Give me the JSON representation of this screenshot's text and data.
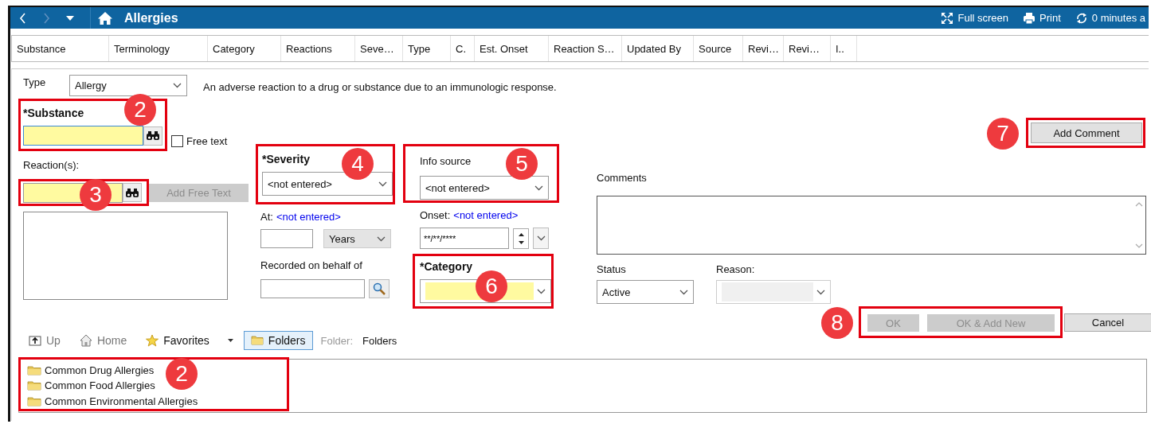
{
  "titlebar": {
    "title": "Allergies",
    "actions": [
      {
        "kind": "fullscreen",
        "label": "Full screen"
      },
      {
        "kind": "print",
        "label": "Print"
      },
      {
        "kind": "refresh",
        "label": "0 minutes a"
      }
    ]
  },
  "columns": [
    "Substance",
    "Terminology",
    "Category",
    "Reactions",
    "Seve…",
    "Type",
    "C.",
    "Est. Onset",
    "Reaction S…",
    "Updated By",
    "Source",
    "Revi…",
    "Revi…",
    "I.."
  ],
  "form": {
    "type": {
      "label": "Type",
      "value": "Allergy",
      "description": "An adverse reaction to a drug or substance due to an immunologic response."
    },
    "substance": {
      "label": "*Substance",
      "required": true,
      "callout": "2",
      "free_text": {
        "label": "Free text",
        "checked": false
      }
    },
    "reactions": {
      "label": "Reaction(s):",
      "required": true,
      "callout": "3",
      "add_button": {
        "label": "Add Free Text",
        "disabled": true
      }
    },
    "severity": {
      "label": "*Severity",
      "value": "<not entered>",
      "callout": "4"
    },
    "at": {
      "label": "At:",
      "link": "<not entered>",
      "unit": "Years"
    },
    "recorded_on_behalf_of": {
      "label": "Recorded on behalf of"
    },
    "info_source": {
      "label": "Info source",
      "value": "<not entered>",
      "callout": "5"
    },
    "onset": {
      "label": "Onset:",
      "link": "<not entered>",
      "value": "**/**/****"
    },
    "category": {
      "label": "*Category",
      "required": true,
      "callout": "6"
    },
    "add_comment": {
      "label": "Add Comment",
      "callout": "7"
    },
    "comments": {
      "label": "Comments"
    },
    "status": {
      "label": "Status",
      "value": "Active"
    },
    "reason": {
      "label": "Reason:",
      "disabled": true
    },
    "actions": {
      "callout": "8",
      "buttons": [
        {
          "label": "OK",
          "disabled": true
        },
        {
          "label": "OK & Add New",
          "disabled": true
        }
      ]
    },
    "cancel": {
      "label": "Cancel",
      "disabled": false
    }
  },
  "browser": {
    "toolbar": [
      {
        "kind": "up",
        "label": "Up",
        "disabled": true,
        "selected": false
      },
      {
        "kind": "home",
        "label": "Home",
        "disabled": true,
        "selected": false
      },
      {
        "kind": "favorites",
        "label": "Favorites",
        "disabled": false,
        "selected": false
      },
      {
        "kind": "folders",
        "label": "Folders",
        "disabled": false,
        "selected": true
      }
    ],
    "folder_label": "Folder:",
    "folder_value": "Folders",
    "folders": {
      "callout": "2",
      "items": [
        "Common Drug Allergies",
        "Common Food Allergies",
        "Common Environmental Allergies"
      ]
    }
  }
}
